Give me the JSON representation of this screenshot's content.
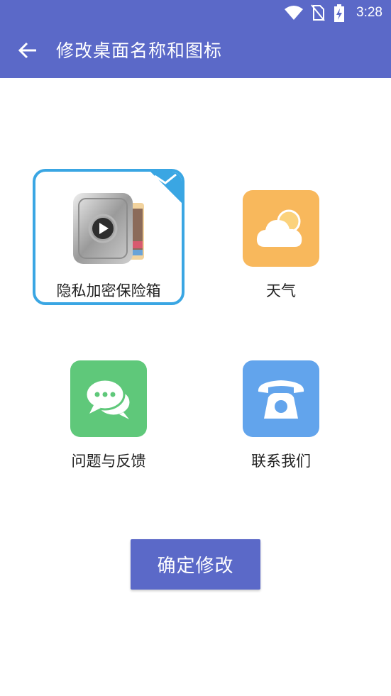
{
  "status_bar": {
    "time": "3:28",
    "icons": [
      "wifi-icon",
      "no-sim-icon",
      "battery-charging-icon"
    ]
  },
  "appbar": {
    "title": "修改桌面名称和图标",
    "back_icon": "arrow-back-icon",
    "color": "#5b69c8"
  },
  "options": [
    {
      "label": "隐私加密保险箱",
      "icon": "vault-icon",
      "selected": true,
      "bg": "#e0e0e0"
    },
    {
      "label": "天气",
      "icon": "cloud-icon",
      "selected": false,
      "bg": "#f8b85c"
    },
    {
      "label": "问题与反馈",
      "icon": "chat-bubbles-icon",
      "selected": false,
      "bg": "#5fc87a"
    },
    {
      "label": "联系我们",
      "icon": "telephone-icon",
      "selected": false,
      "bg": "#62a4ec"
    }
  ],
  "selection_color": "#3aa6e3",
  "confirm_button": {
    "label": "确定修改"
  }
}
